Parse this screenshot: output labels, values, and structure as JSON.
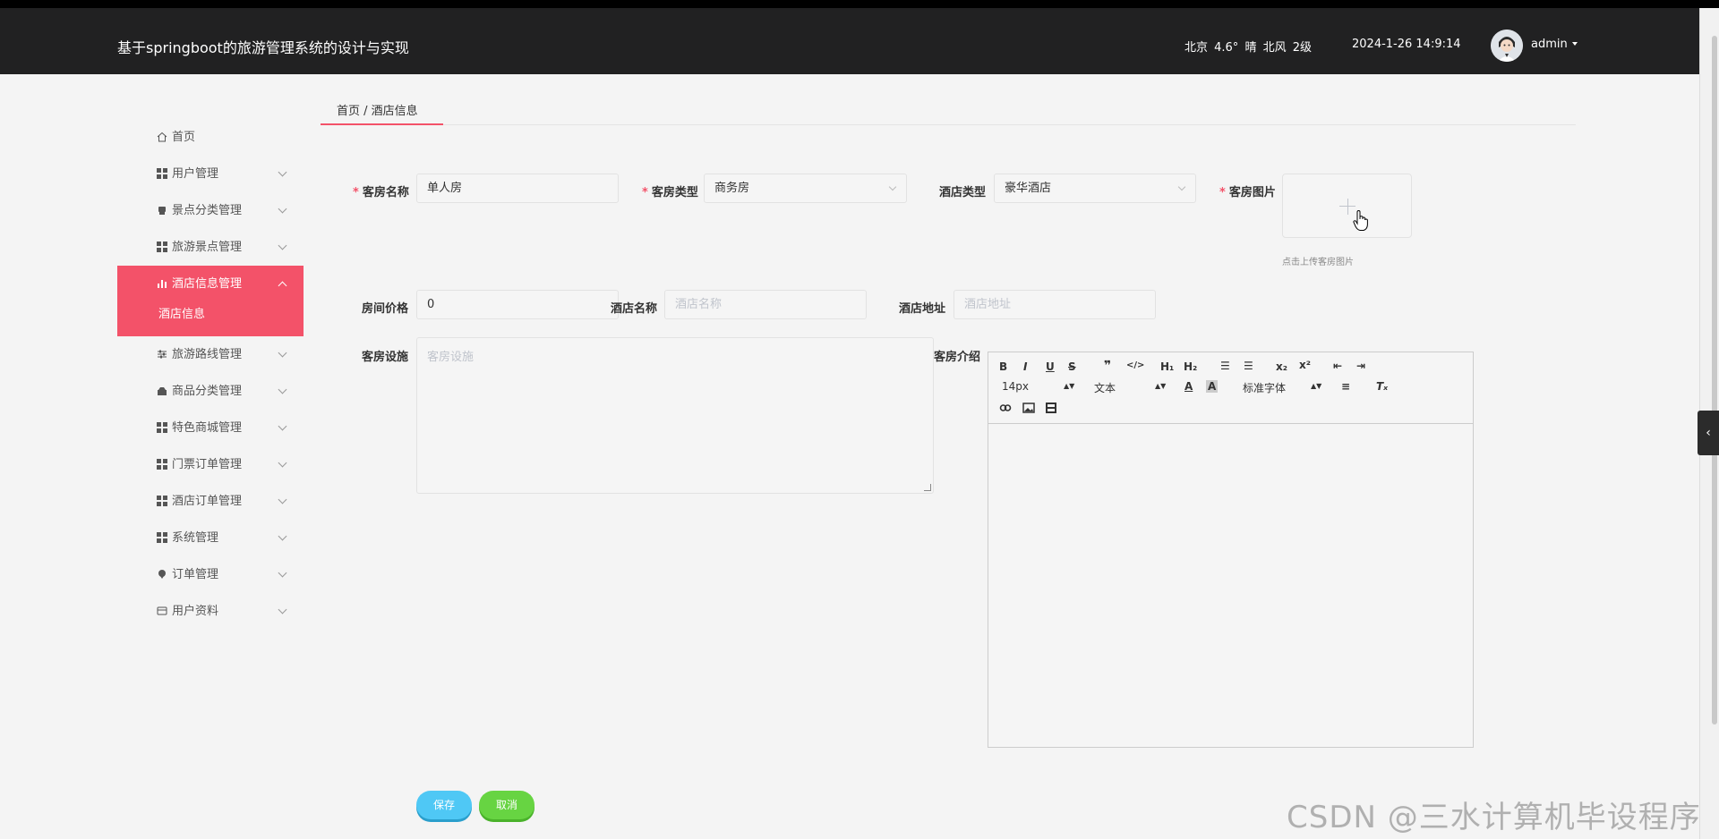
{
  "header": {
    "title": "基于springboot的旅游管理系统的设计与实现",
    "weather": "北京  4.6°  晴  北风  2级",
    "datetime": "2024-1-26 14:9:14",
    "username": "admin"
  },
  "sidebar": {
    "items": [
      {
        "label": "首页",
        "icon": "home-icon"
      },
      {
        "label": "用户管理",
        "icon": "grid-icon"
      },
      {
        "label": "景点分类管理",
        "icon": "tag-icon"
      },
      {
        "label": "旅游景点管理",
        "icon": "grid-icon"
      },
      {
        "label": "酒店信息管理",
        "icon": "bar-chart-icon"
      },
      {
        "label": "旅游路线管理",
        "icon": "sliders-icon"
      },
      {
        "label": "商品分类管理",
        "icon": "shop-icon"
      },
      {
        "label": "特色商城管理",
        "icon": "grid-icon"
      },
      {
        "label": "门票订单管理",
        "icon": "grid-icon"
      },
      {
        "label": "酒店订单管理",
        "icon": "grid-icon"
      },
      {
        "label": "系统管理",
        "icon": "grid-icon"
      },
      {
        "label": "订单管理",
        "icon": "pin-icon"
      },
      {
        "label": "用户资料",
        "icon": "card-icon"
      }
    ],
    "submenu": "酒店信息"
  },
  "breadcrumb": "首页 / 酒店信息",
  "form": {
    "room_name_label": "客房名称",
    "room_name_value": "单人房",
    "room_type_label": "客房类型",
    "room_type_value": "商务房",
    "hotel_type_label": "酒店类型",
    "hotel_type_value": "豪华酒店",
    "room_image_label": "客房图片",
    "upload_tip": "点击上传客房图片",
    "price_label": "房间价格",
    "price_value": "0",
    "hotel_name_label": "酒店名称",
    "hotel_name_placeholder": "酒店名称",
    "hotel_address_label": "酒店地址",
    "hotel_address_placeholder": "酒店地址",
    "facilities_label": "客房设施",
    "facilities_placeholder": "客房设施",
    "intro_label": "客房介绍"
  },
  "editor": {
    "font_size": "14px",
    "text_type": "文本",
    "font_family": "标准字体"
  },
  "buttons": {
    "save": "保存",
    "cancel": "取消"
  },
  "watermark": "CSDN @三水计算机毕设程序"
}
